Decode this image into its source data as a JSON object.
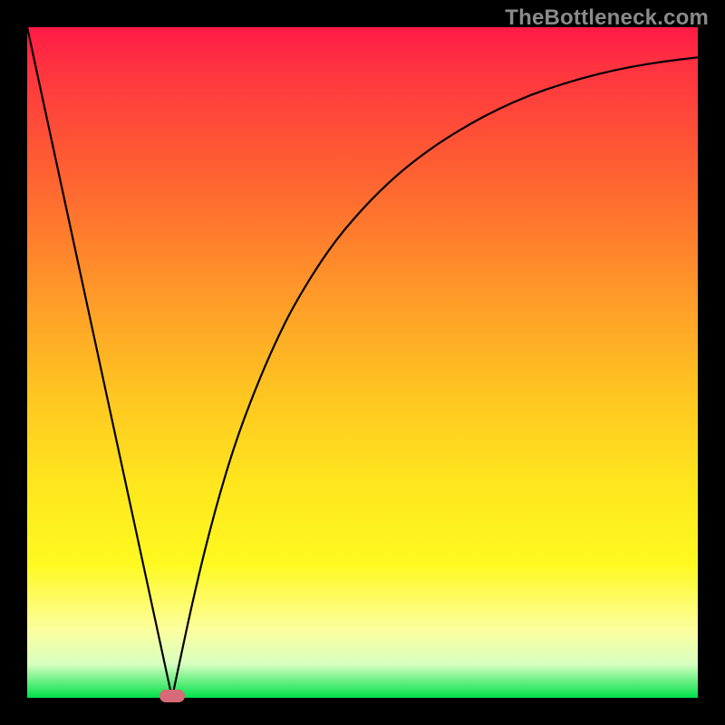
{
  "watermark": "TheBottleneck.com",
  "chart_data": {
    "type": "line",
    "title": "",
    "xlabel": "",
    "ylabel": "",
    "xlim": [
      0,
      1
    ],
    "ylim": [
      0,
      1
    ],
    "grid": false,
    "legend": false,
    "series": [
      {
        "name": "left-segment",
        "x": [
          0.0,
          0.216
        ],
        "y": [
          1.0,
          0.0
        ]
      },
      {
        "name": "right-segment",
        "x": [
          0.216,
          0.25,
          0.28,
          0.31,
          0.34,
          0.37,
          0.4,
          0.45,
          0.5,
          0.55,
          0.6,
          0.65,
          0.7,
          0.75,
          0.8,
          0.85,
          0.9,
          0.95,
          1.0
        ],
        "y": [
          0.0,
          0.16,
          0.28,
          0.38,
          0.46,
          0.53,
          0.59,
          0.67,
          0.73,
          0.779,
          0.818,
          0.85,
          0.877,
          0.899,
          0.916,
          0.93,
          0.941,
          0.949,
          0.955
        ]
      }
    ],
    "marker": {
      "x_frac": 0.216,
      "y_frac": 0.0
    },
    "colors": {
      "curve": "#000000",
      "background_top": "#ff1a46",
      "background_bottom": "#00e048",
      "marker": "#d66a78",
      "frame": "#000000"
    }
  }
}
